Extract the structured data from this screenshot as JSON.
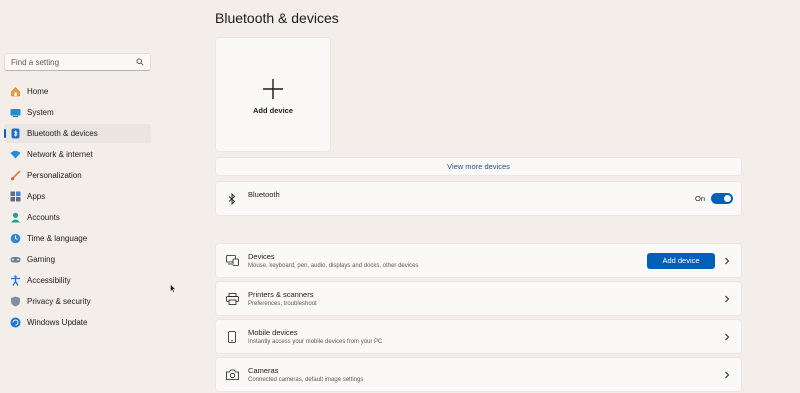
{
  "sidebar": {
    "search_placeholder": "Find a setting",
    "items": [
      {
        "label": "Home"
      },
      {
        "label": "System"
      },
      {
        "label": "Bluetooth & devices"
      },
      {
        "label": "Network & internet"
      },
      {
        "label": "Personalization"
      },
      {
        "label": "Apps"
      },
      {
        "label": "Accounts"
      },
      {
        "label": "Time & language"
      },
      {
        "label": "Gaming"
      },
      {
        "label": "Accessibility"
      },
      {
        "label": "Privacy & security"
      },
      {
        "label": "Windows Update"
      }
    ]
  },
  "main": {
    "title": "Bluetooth & devices",
    "add_card_label": "Add device",
    "view_more": "View more devices",
    "bluetooth": {
      "title": "Bluetooth",
      "state": "On"
    },
    "rows": [
      {
        "title": "Devices",
        "subtitle": "Mouse, keyboard, pen, audio, displays and docks, other devices",
        "button": "Add device"
      },
      {
        "title": "Printers & scanners",
        "subtitle": "Preferences, troubleshoot"
      },
      {
        "title": "Mobile devices",
        "subtitle": "Instantly access your mobile devices from your PC"
      },
      {
        "title": "Cameras",
        "subtitle": "Connected cameras, default image settings"
      }
    ]
  },
  "colors": {
    "accent": "#005fb8",
    "background": "#f4eeea",
    "card": "#fbf9f8"
  }
}
